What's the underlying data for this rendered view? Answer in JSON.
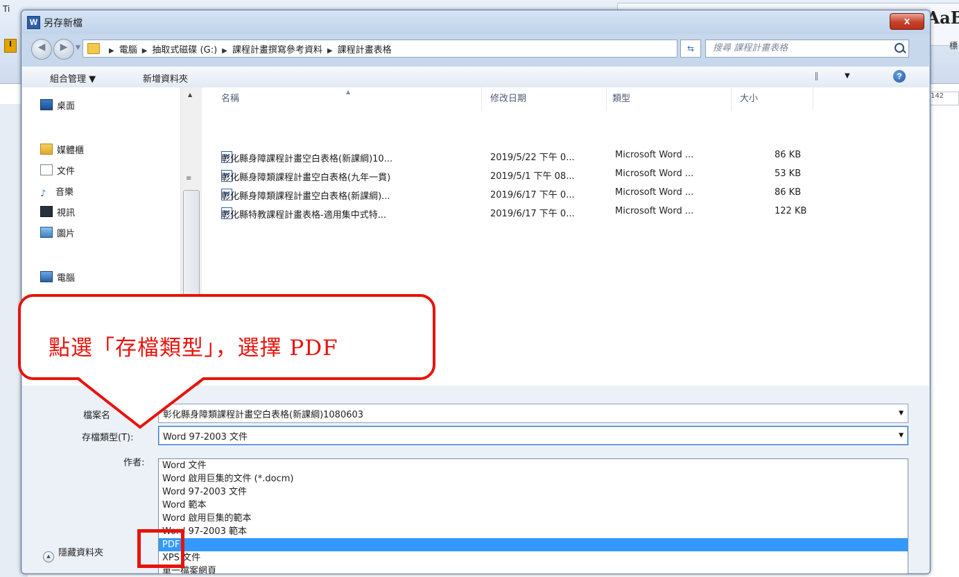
{
  "word": {
    "styles_preview": "AaB",
    "styles_caption": "標",
    "ruler_number": "142",
    "toolbar_left_text": "Ti",
    "toolbar_left_badge": "I"
  },
  "dialog": {
    "title_icon_letter": "W",
    "title": "另存新檔",
    "close_label": "x"
  },
  "address": {
    "crumbs": [
      "電腦",
      "抽取式磁碟 (G:)",
      "課程計畫撰寫參考資料",
      "課程計畫表格"
    ],
    "search_placeholder": "搜尋 課程計畫表格"
  },
  "toolbar": {
    "organize_label": "組合管理 ▼",
    "new_folder_label": "新增資料夾",
    "help_label": "?"
  },
  "nav": {
    "items": [
      {
        "label": "桌面",
        "icon": "desktop-icon"
      },
      {
        "label": "媒體櫃",
        "icon": "library-icon"
      },
      {
        "label": "文件",
        "icon": "documents-icon"
      },
      {
        "label": "音樂",
        "icon": "music-icon"
      },
      {
        "label": "視訊",
        "icon": "video-icon"
      },
      {
        "label": "圖片",
        "icon": "pictures-icon"
      },
      {
        "label": "電腦",
        "icon": "computer-icon"
      }
    ]
  },
  "files": {
    "columns": {
      "name": "名稱",
      "date": "修改日期",
      "type": "類型",
      "size": "大小"
    },
    "rows": [
      {
        "name": "彰化縣身障課程計畫空白表格(新課綱)10...",
        "date": "2019/5/22 下午 0...",
        "type": "Microsoft Word ...",
        "size": "86 KB"
      },
      {
        "name": "彰化縣身障類課程計畫空白表格(九年一貫)",
        "date": "2019/5/1 下午 08...",
        "type": "Microsoft Word ...",
        "size": "53 KB"
      },
      {
        "name": "彰化縣身障類課程計畫空白表格(新課綱)...",
        "date": "2019/6/17 下午 0...",
        "type": "Microsoft Word ...",
        "size": "86 KB"
      },
      {
        "name": "彰化縣特教課程計畫表格-適用集中式特...",
        "date": "2019/6/17 下午 0...",
        "type": "Microsoft Word ...",
        "size": "122 KB"
      }
    ]
  },
  "form": {
    "filename_label": "檔案名",
    "filename_value": "彰化縣身障類課程計畫空白表格(新課綱)1080603",
    "filetype_label": "存檔類型(T):",
    "filetype_value": "Word 97-2003 文件",
    "author_label": "作者:",
    "filetype_options": [
      "Word 文件",
      "Word 啟用巨集的文件 (*.docm)",
      "Word 97-2003 文件",
      "Word 範本",
      "Word 啟用巨集的範本",
      "Word 97-2003 範本",
      "PDF",
      "XPS 文件",
      "單一檔案網頁"
    ],
    "selected_option": "PDF",
    "hide_folders_label": "隱藏資料夾"
  },
  "annotation": {
    "callout_text": "點選「存檔類型」，選擇 PDF",
    "color": "#e8130c"
  }
}
